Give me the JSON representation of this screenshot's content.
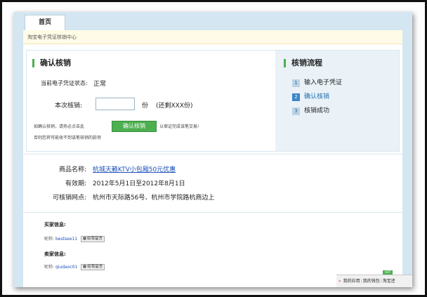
{
  "tab": {
    "home": "首页"
  },
  "notice": {
    "text": "淘宝电子凭证核销中心"
  },
  "confirm": {
    "title": "确认核销",
    "status_label": "当前电子凭证状态:",
    "status_value": "正常",
    "amount_label": "本次核销:",
    "amount_unit": "份",
    "remaining": "(还剩XXX份)",
    "hint_before": "如确认核销，请务必点击此",
    "button": "确认核销",
    "hint_after": "以保证完成该笔交易!",
    "warning": "否则您将可能收不到该笔核销的款项"
  },
  "flow": {
    "title": "核销流程",
    "steps": [
      {
        "num": "1",
        "label": "输入电子凭证"
      },
      {
        "num": "2",
        "label": "确认核销"
      },
      {
        "num": "3",
        "label": "核销成功"
      }
    ]
  },
  "product": {
    "name_label": "商品名称:",
    "name_value": "杭城天籁KTV小包厢50元优惠",
    "validity_label": "有效期:",
    "validity_value": "2012年5月1日至2012年8月1日",
    "locations_label": "可核销网点:",
    "locations_value": "杭州市天际路56号、杭州市学院路杭商边上"
  },
  "parties": {
    "buyer_title": "买家信息:",
    "buyer_prefix": "昵称:",
    "buyer_nick": "bestsee11",
    "seller_title": "卖家信息:",
    "seller_prefix": "昵称:",
    "seller_nick": "qiudaoc01",
    "message_button": "给我留言"
  },
  "bottom_bar": {
    "arrows": "»",
    "apps": "我的应用",
    "wallet": "我的钱包",
    "taobao": "淘宝还",
    "flag": "HOT"
  }
}
